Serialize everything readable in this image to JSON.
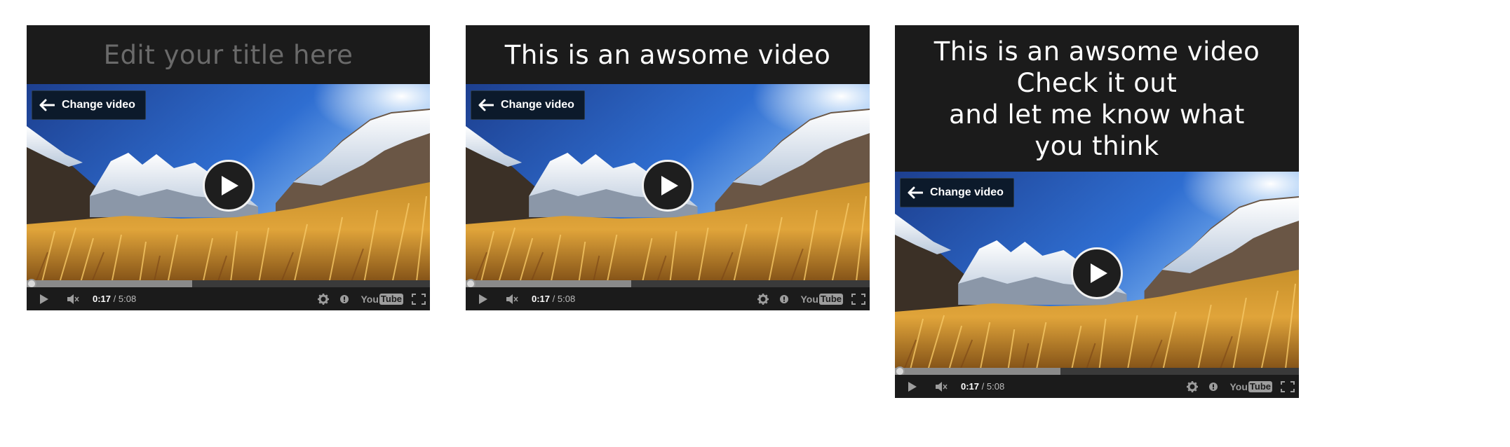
{
  "cards": [
    {
      "title_lines": [
        "Edit your title here"
      ],
      "title_is_placeholder": true,
      "change_video_label": "Change video",
      "time_current": "0:17",
      "time_separator": " / ",
      "time_total": "5:08",
      "progress": 0.41,
      "youtube_you": "You",
      "youtube_tube": "Tube"
    },
    {
      "title_lines": [
        "This is an awsome video"
      ],
      "title_is_placeholder": false,
      "change_video_label": "Change video",
      "time_current": "0:17",
      "time_separator": " / ",
      "time_total": "5:08",
      "progress": 0.41,
      "youtube_you": "You",
      "youtube_tube": "Tube"
    },
    {
      "title_lines": [
        "This is an awsome video",
        "Check it out",
        "and let me know what",
        "you think"
      ],
      "title_is_placeholder": false,
      "change_video_label": "Change video",
      "time_current": "0:17",
      "time_separator": " / ",
      "time_total": "5:08",
      "progress": 0.41,
      "youtube_you": "You",
      "youtube_tube": "Tube"
    }
  ],
  "icons": {
    "back": "arrow-left-icon",
    "play_overlay": "play-icon",
    "play_small": "play-icon",
    "volume": "volume-icon",
    "settings": "gear-icon",
    "info": "info-icon",
    "youtube": "youtube-logo",
    "fullscreen": "fullscreen-icon"
  },
  "colors": {
    "card_bg": "#1b1b1b",
    "title_text": "#ffffff",
    "title_placeholder": "#6a6a6a",
    "button_bg": "#0c1a2b"
  }
}
